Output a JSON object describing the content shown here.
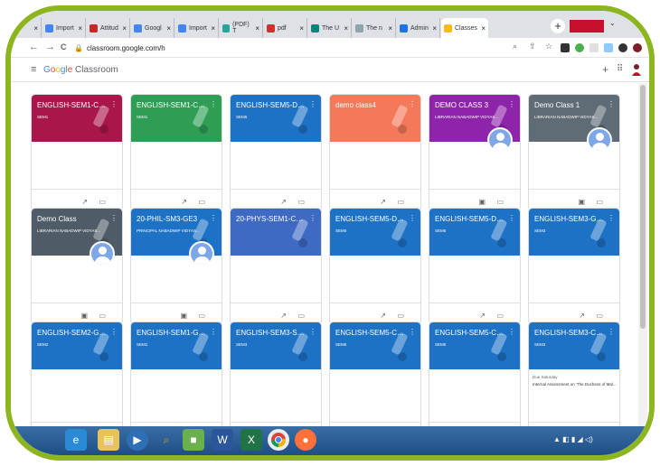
{
  "browser": {
    "tabs": [
      {
        "label": "",
        "close": "×",
        "color": "#1a73e8"
      },
      {
        "label": "Import",
        "close": "×",
        "color": "#4285f4"
      },
      {
        "label": "Attitud",
        "close": "×",
        "color": "#c62828"
      },
      {
        "label": "Googl",
        "close": "×",
        "color": "#4285f4"
      },
      {
        "label": "Import",
        "close": "×",
        "color": "#4285f4"
      },
      {
        "label": "(PDF) T",
        "close": "×",
        "color": "#26a69a"
      },
      {
        "label": "pdf",
        "close": "×",
        "color": "#d32f2f"
      },
      {
        "label": "The U",
        "close": "×",
        "color": "#00897b"
      },
      {
        "label": "The n",
        "close": "×",
        "color": "#90a4ae"
      },
      {
        "label": "Admin",
        "close": "×",
        "color": "#1a73e8"
      },
      {
        "label": "Classes",
        "close": "×",
        "color": "#fbbc05",
        "active": true
      }
    ],
    "new_tab": "+",
    "dropdown": "⌄",
    "url": "classroom.google.com/h",
    "back": "←",
    "forward": "→",
    "reload": "C",
    "lock": "🔒"
  },
  "app": {
    "menu": "≡",
    "brand": {
      "google": [
        "G",
        "o",
        "o",
        "g",
        "l",
        "e"
      ],
      "product": "Classroom"
    },
    "plus": "+",
    "apps": "⠿"
  },
  "colors": {
    "frame": "#8db51f",
    "blue": "#1e72c6",
    "green": "#2e9e55",
    "crimson": "#a9164b",
    "orange": "#f4795b",
    "purple": "#8e24aa",
    "slate": "#5f6b75",
    "darkslate": "#4f5b66",
    "indigo": "#3f6ac4"
  },
  "cards": [
    {
      "title": "ENGLISH-SEM1-CC2...",
      "subtitle": "SEM1",
      "color": "#a9164b",
      "avatar": false,
      "footer": [
        "trend",
        "folder"
      ]
    },
    {
      "title": "ENGLISH-SEM1-CC1",
      "subtitle": "SEM1",
      "color": "#2e9e55",
      "avatar": false,
      "footer": [
        "trend",
        "folder"
      ]
    },
    {
      "title": "ENGLISH-SEM5-DSE...",
      "subtitle": "SEM5",
      "color": "#1e72c6",
      "avatar": false,
      "footer": [
        "trend",
        "folder"
      ]
    },
    {
      "title": "demo class4",
      "subtitle": "",
      "color": "#f4795b",
      "avatar": false,
      "footer": [
        "trend",
        "folder"
      ]
    },
    {
      "title": "DEMO CLASS 3",
      "subtitle": "LIBRARIAN NABADWIP VIDYAS...",
      "color": "#8e24aa",
      "avatar": true,
      "footer": [
        "clipboard",
        "folder"
      ]
    },
    {
      "title": "Demo Class 1",
      "subtitle": "LIBRARIAN NABADWIP VIDYAS...",
      "color": "#5f6b75",
      "avatar": true,
      "footer": [
        "clipboard",
        "folder"
      ]
    },
    {
      "title": "Demo Class",
      "subtitle": "LIBRARIAN NABADWIP VIDYAS...",
      "color": "#4f5b66",
      "avatar": true,
      "footer": [
        "clipboard",
        "folder"
      ]
    },
    {
      "title": "20-PHIL-SM3-GE3",
      "subtitle": "PRINCIPAL NABADWIP VIDYAS...",
      "color": "#1e72c6",
      "avatar": true,
      "footer": [
        "clipboard",
        "folder"
      ]
    },
    {
      "title": "20-PHYS-SEM1-CC2...",
      "subtitle": "",
      "color": "#3f6ac4",
      "avatar": false,
      "footer": [
        "trend",
        "folder"
      ]
    },
    {
      "title": "ENGLISH-SEM5-DSE...",
      "subtitle": "SEM5",
      "color": "#1e72c6",
      "avatar": false,
      "footer": [
        "trend",
        "folder"
      ]
    },
    {
      "title": "ENGLISH-SEM5-DSE...",
      "subtitle": "SEM5",
      "color": "#1e72c6",
      "avatar": false,
      "footer": [
        "trend",
        "folder"
      ]
    },
    {
      "title": "ENGLISH-SEM3-GE3...",
      "subtitle": "SEM3",
      "color": "#1e72c6",
      "avatar": false,
      "footer": [
        "trend",
        "folder"
      ]
    },
    {
      "title": "ENGLISH-SEM2-GE2...",
      "subtitle": "SEM2",
      "color": "#1e72c6",
      "avatar": false,
      "footer": [
        "trend",
        "folder"
      ]
    },
    {
      "title": "ENGLISH-SEM1-GE1-...",
      "subtitle": "SEM1",
      "color": "#1e72c6",
      "avatar": false,
      "footer": [
        "trend",
        "folder"
      ]
    },
    {
      "title": "ENGLISH-SEM3-SEC...",
      "subtitle": "SEM3",
      "color": "#1e72c6",
      "avatar": false,
      "footer": [
        "trend",
        "folder"
      ]
    },
    {
      "title": "ENGLISH-SEM5-CC1...",
      "subtitle": "SEM5",
      "color": "#1e72c6",
      "avatar": false,
      "footer": [
        "trend",
        "folder"
      ]
    },
    {
      "title": "ENGLISH-SEM5-CC1...",
      "subtitle": "SEM5",
      "color": "#1e72c6",
      "avatar": false,
      "footer": [
        "trend",
        "folder"
      ]
    },
    {
      "title": "ENGLISH-SEM3-CC7...",
      "subtitle": "SEM3",
      "color": "#1e72c6",
      "avatar": false,
      "footer": [
        "trend",
        "folder"
      ],
      "due": "Due Saturday",
      "due_text": "Internal Assessment on 'The Duchess of Mal..."
    }
  ],
  "icons": {
    "trend": "↗",
    "folder": "▭",
    "clipboard": "▣",
    "kebab": "⋮"
  },
  "taskbar": {
    "tray": "▲ ◧ ▮ ◢ ◁)"
  }
}
